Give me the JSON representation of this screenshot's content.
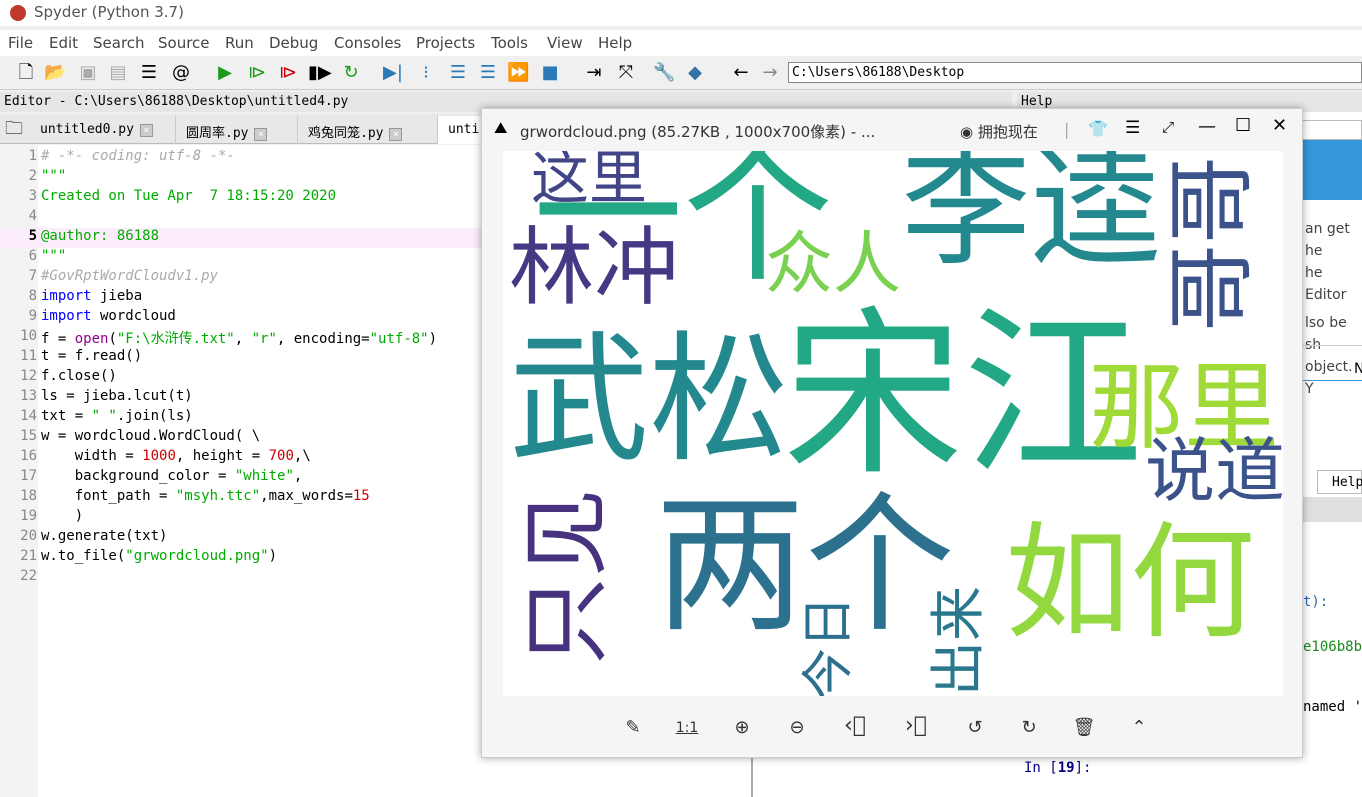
{
  "app": {
    "title": "Spyder (Python 3.7)"
  },
  "menu": [
    "File",
    "Edit",
    "Search",
    "Source",
    "Run",
    "Debug",
    "Consoles",
    "Projects",
    "Tools",
    "View",
    "Help"
  ],
  "toolbar": {
    "path": "C:\\Users\\86188\\Desktop",
    "icons": [
      "new-file-icon",
      "open-icon",
      "save-icon",
      "save-all-icon",
      "outline-icon",
      "at-icon",
      "run-icon",
      "run-cell-icon",
      "run-cell-advance-icon",
      "run-selection-icon",
      "rerun-icon",
      "debug-icon",
      "step-icon",
      "step-into-icon",
      "step-return-icon",
      "continue-icon",
      "stop-icon",
      "maximize-pane-icon",
      "fullscreen-icon",
      "wrench-icon",
      "python-icon",
      "back-icon",
      "forward-icon"
    ]
  },
  "editor": {
    "header": "Editor - C:\\Users\\86188\\Desktop\\untitled4.py",
    "tabs": [
      "untitled0.py",
      "圆周率.py",
      "鸡兔同笼.py",
      "unti"
    ],
    "lines": [
      [
        [
          "cm",
          "# -*- coding: utf-8 -*-"
        ]
      ],
      [
        [
          "str",
          "\"\"\""
        ]
      ],
      [
        [
          "str",
          "Created on Tue Apr  7 18:15:20 2020"
        ]
      ],
      [],
      [
        [
          "str",
          "@author: 86188"
        ]
      ],
      [
        [
          "str",
          "\"\"\""
        ]
      ],
      [
        [
          "cm",
          "#GovRptWordCloudv1.py"
        ]
      ],
      [
        [
          "kw",
          "import"
        ],
        [
          "fn",
          " jieba"
        ]
      ],
      [
        [
          "kw",
          "import"
        ],
        [
          "fn",
          " wordcloud"
        ]
      ],
      [
        [
          "fn",
          "f = "
        ],
        [
          "bi",
          "open"
        ],
        [
          "fn",
          "("
        ],
        [
          "str",
          "\"F:\\水浒传.txt\""
        ],
        [
          "fn",
          ", "
        ],
        [
          "str",
          "\"r\""
        ],
        [
          "fn",
          ", encoding="
        ],
        [
          "str",
          "\"utf-8\""
        ],
        [
          "fn",
          ")"
        ]
      ],
      [
        [
          "fn",
          "t = f.read()"
        ]
      ],
      [
        [
          "fn",
          "f.close()"
        ]
      ],
      [
        [
          "fn",
          "ls = jieba.lcut(t)"
        ]
      ],
      [
        [
          "fn",
          "txt = "
        ],
        [
          "str",
          "\" \""
        ],
        [
          "fn",
          ".join(ls)"
        ]
      ],
      [
        [
          "fn",
          "w = wordcloud.WordCloud( \\"
        ]
      ],
      [
        [
          "fn",
          "    width = "
        ],
        [
          "num",
          "1000"
        ],
        [
          "fn",
          ", height = "
        ],
        [
          "num",
          "700"
        ],
        [
          "fn",
          ",\\"
        ]
      ],
      [
        [
          "fn",
          "    background_color = "
        ],
        [
          "str",
          "\"white\""
        ],
        [
          "fn",
          ","
        ]
      ],
      [
        [
          "fn",
          "    font_path = "
        ],
        [
          "str",
          "\"msyh.ttc\""
        ],
        [
          "fn",
          ",max_words="
        ],
        [
          "num",
          "15"
        ]
      ],
      [
        [
          "fn",
          "    )"
        ]
      ],
      [
        [
          "fn",
          "w.generate(txt)"
        ]
      ],
      [
        [
          "fn",
          "w.to_file("
        ],
        [
          "str",
          "\"grwordcloud.png\""
        ],
        [
          "fn",
          ")"
        ]
      ],
      []
    ],
    "current_line": 5
  },
  "help": {
    "header": "Help",
    "text": [
      "an get he",
      "he Editor",
      "lso be sh",
      "object. Y"
    ],
    "tab": "Help",
    "n": "N"
  },
  "console": {
    "lines": [
      "t):",
      "e106b8b",
      "named '"
    ],
    "prompt": "In [",
    "prompt_num": "19",
    "prompt_end": "]:"
  },
  "viewer": {
    "title": "grwordcloud.png (85.27KB , 1000x700像素) - ...",
    "promo": "拥抱现在",
    "zoom_label": "1:1",
    "words": [
      {
        "text": "这里",
        "color": "#414487"
      },
      {
        "text": "一个",
        "color": "#22a884"
      },
      {
        "text": "李逵",
        "color": "#23898e"
      },
      {
        "text": "哥哥",
        "color": "#3b528b"
      },
      {
        "text": "林冲",
        "color": "#443983"
      },
      {
        "text": "众人",
        "color": "#7ad151"
      },
      {
        "text": "武松",
        "color": "#23898e"
      },
      {
        "text": "宋江",
        "color": "#22a884"
      },
      {
        "text": "那里",
        "color": "#a0da39"
      },
      {
        "text": "说道",
        "color": "#3b528b"
      },
      {
        "text": "只见",
        "color": "#46327e"
      },
      {
        "text": "两个",
        "color": "#2c728e"
      },
      {
        "text": "今日",
        "color": "#2d708e"
      },
      {
        "text": "出来",
        "color": "#2a788e"
      },
      {
        "text": "如何",
        "color": "#94d840"
      }
    ]
  }
}
